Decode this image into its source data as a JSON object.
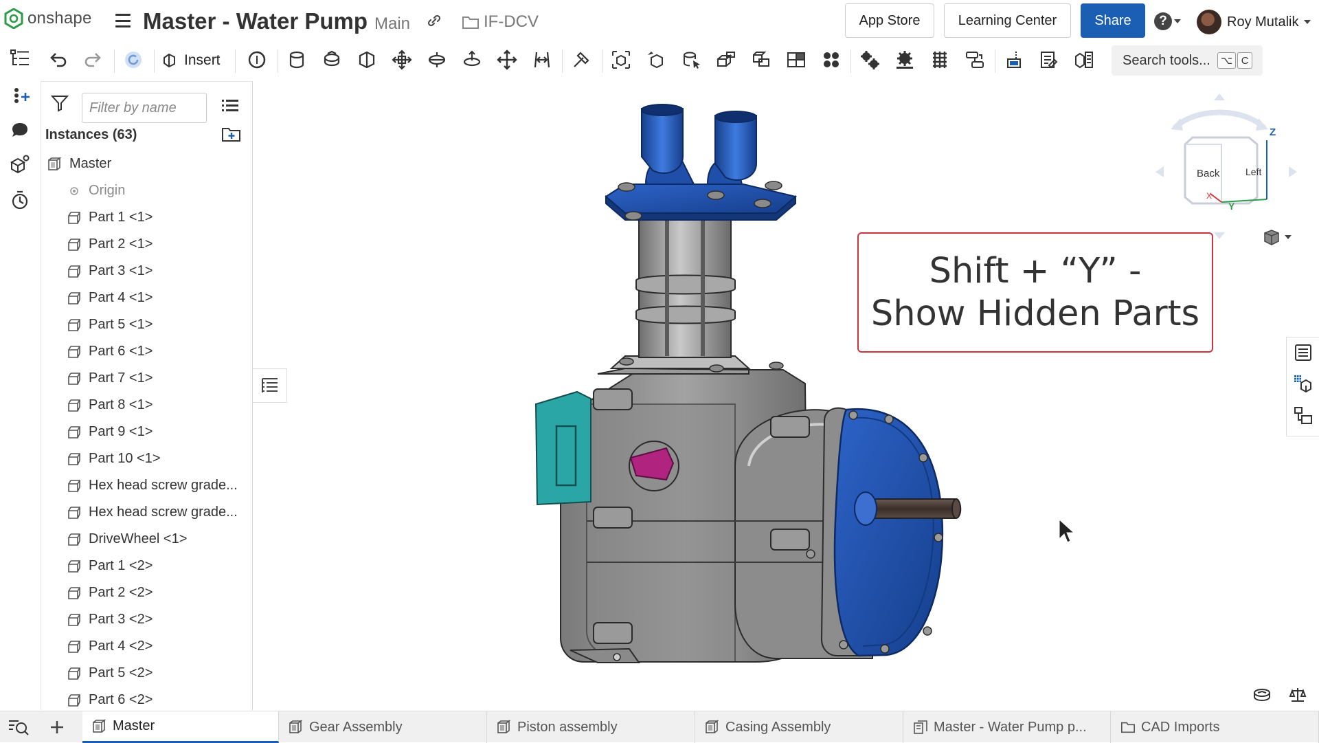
{
  "app": {
    "logo_text": "onshape",
    "doc_title": "Master - Water Pump",
    "branch": "Main",
    "folder": "IF-DCV"
  },
  "header": {
    "app_store": "App Store",
    "learning_center": "Learning Center",
    "share": "Share",
    "help_glyph": "?",
    "user_name": "Roy Mutalik"
  },
  "toolbar": {
    "insert_label": "Insert",
    "search_placeholder": "Search tools...",
    "search_key_1": "⌥",
    "search_key_2": "C",
    "icons": [
      "undo-icon",
      "redo-icon",
      "update-icon",
      "insert-icon",
      "mate-connector-icon",
      "fastened-mate-icon",
      "revolute-mate-icon",
      "slider-mate-icon",
      "planar-mate-icon",
      "cylindrical-mate-icon",
      "pin-slot-mate-icon",
      "ball-mate-icon",
      "parallel-mate-icon",
      "tangent-mate-icon",
      "mate-group-icon",
      "replicate-icon",
      "pattern-icon",
      "mirror-icon",
      "relation-icon",
      "gear-relation-icon",
      "rack-pinion-icon",
      "screw-relation-icon",
      "linear-relation-icon",
      "explode-icon",
      "animate-icon",
      "simulation-icon",
      "measure-icon",
      "section-view-icon",
      "bom-icon"
    ]
  },
  "panel": {
    "filter_placeholder": "Filter by name",
    "instances_header": "Instances (63)",
    "tree": [
      {
        "label": "Master",
        "kind": "assembly",
        "indent": 0
      },
      {
        "label": "Origin",
        "kind": "origin",
        "indent": 1
      },
      {
        "label": "Part 1 <1>",
        "kind": "part",
        "indent": 1
      },
      {
        "label": "Part 2 <1>",
        "kind": "part",
        "indent": 1
      },
      {
        "label": "Part 3 <1>",
        "kind": "part",
        "indent": 1
      },
      {
        "label": "Part 4 <1>",
        "kind": "part",
        "indent": 1
      },
      {
        "label": "Part 5 <1>",
        "kind": "part",
        "indent": 1
      },
      {
        "label": "Part 6 <1>",
        "kind": "part",
        "indent": 1
      },
      {
        "label": "Part 7 <1>",
        "kind": "part",
        "indent": 1
      },
      {
        "label": "Part 8 <1>",
        "kind": "part",
        "indent": 1
      },
      {
        "label": "Part 9 <1>",
        "kind": "part",
        "indent": 1
      },
      {
        "label": "Part 10 <1>",
        "kind": "part",
        "indent": 1
      },
      {
        "label": "Hex head screw grade...",
        "kind": "part",
        "indent": 1
      },
      {
        "label": "Hex head screw grade...",
        "kind": "part",
        "indent": 1
      },
      {
        "label": "DriveWheel <1>",
        "kind": "part",
        "indent": 1
      },
      {
        "label": "Part 1 <2>",
        "kind": "part",
        "indent": 1
      },
      {
        "label": "Part 2 <2>",
        "kind": "part",
        "indent": 1
      },
      {
        "label": "Part 3 <2>",
        "kind": "part",
        "indent": 1
      },
      {
        "label": "Part 4 <2>",
        "kind": "part",
        "indent": 1
      },
      {
        "label": "Part 5 <2>",
        "kind": "part",
        "indent": 1
      },
      {
        "label": "Part 6 <2>",
        "kind": "part",
        "indent": 1
      }
    ]
  },
  "overlay": {
    "line1": "Shift + “Y” -",
    "line2": "Show Hidden Parts"
  },
  "viewcube": {
    "face_back": "Back",
    "face_left": "Left",
    "axis_z": "Z",
    "axis_x": "X",
    "axis_y": "Y"
  },
  "tabs": [
    {
      "label": "Master",
      "icon": "assembly-tab-icon",
      "active": true
    },
    {
      "label": "Gear Assembly",
      "icon": "assembly-tab-icon",
      "active": false
    },
    {
      "label": "Piston assembly",
      "icon": "assembly-tab-icon",
      "active": false
    },
    {
      "label": "Casing Assembly",
      "icon": "assembly-tab-icon",
      "active": false
    },
    {
      "label": "Master - Water Pump p...",
      "icon": "drawing-tab-icon",
      "active": false
    },
    {
      "label": "CAD Imports",
      "icon": "folder-tab-icon",
      "active": false
    }
  ],
  "colors": {
    "brand_blue": "#1a5fb4",
    "overlay_border": "#c9343c",
    "pump_blue": "#1f4fa8",
    "pump_gray": "#8e8e8e",
    "pump_teal": "#2aa6a6",
    "pump_magenta": "#b0237e"
  }
}
